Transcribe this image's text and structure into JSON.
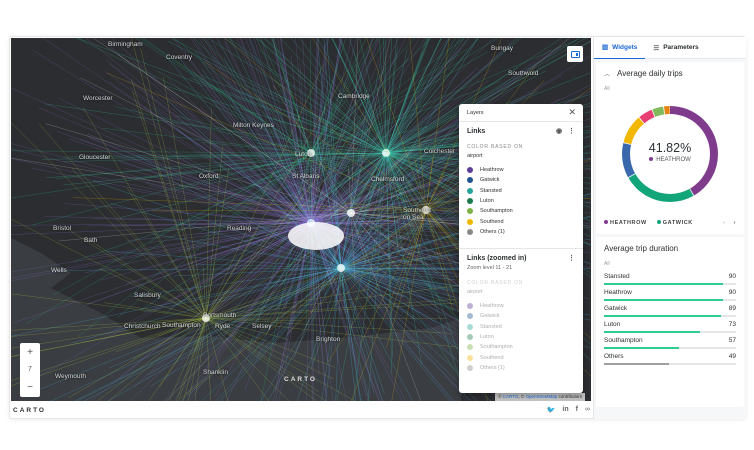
{
  "map": {
    "cities": [
      "Birmingham",
      "Coventry",
      "Bungay",
      "Southwold",
      "Worcester",
      "Cambridge",
      "Milton Keynes",
      "Luton",
      "Colchester",
      "Gloucester",
      "Oxford",
      "St Albans",
      "Chelmsford",
      "Southend",
      "on Sea",
      "Bristol",
      "Bath",
      "Reading",
      "Wells",
      "Salisbury",
      "Southampton",
      "Portsmouth",
      "Ryde",
      "Selsey",
      "Brighton",
      "Christchurch",
      "Weymouth",
      "Shanklin"
    ],
    "zoom_in": "+",
    "zoom_level": "7",
    "zoom_out": "−",
    "watermark": "CARTO",
    "attribution": {
      "prefix": "© ",
      "carto": "CARTO",
      "sep": ", © ",
      "osm": "OpenStreetMap",
      "suffix": " contributors"
    }
  },
  "layers": {
    "title": "Layers",
    "links": {
      "title": "Links",
      "color_based_on": "COLOR BASED ON",
      "attribute": "airport",
      "items": [
        {
          "label": "Heathrow",
          "color": "#5e3c99"
        },
        {
          "label": "Gatwick",
          "color": "#1f5591"
        },
        {
          "label": "Stansted",
          "color": "#26a69a"
        },
        {
          "label": "Luton",
          "color": "#1b7a4a"
        },
        {
          "label": "Southampton",
          "color": "#7cb342"
        },
        {
          "label": "Southend",
          "color": "#f2b701"
        },
        {
          "label": "Others (1)",
          "color": "#888888"
        }
      ]
    },
    "links_zoomed": {
      "title": "Links (zoomed in)",
      "zoom_range": "Zoom level 11 - 21",
      "color_based_on": "COLOR BASED ON",
      "attribute": "airport",
      "items": [
        "Heathrow",
        "Gatwick",
        "Stansted",
        "Luton",
        "Southampton",
        "Southend",
        "Others (1)"
      ]
    }
  },
  "footer": {
    "logo": "CARTO",
    "social": [
      "twitter-icon",
      "linkedin-icon",
      "facebook-icon",
      "link-icon"
    ]
  },
  "panel": {
    "tabs": [
      {
        "label": "Widgets",
        "active": true
      },
      {
        "label": "Parameters",
        "active": false
      }
    ],
    "daily": {
      "title": "Average daily trips",
      "filter": "All",
      "center_value": "41.82%",
      "center_label": "HEATHROW",
      "segments": [
        {
          "name": "HEATHROW",
          "share": 0.4182,
          "color": "#7f3c8d"
        },
        {
          "name": "GATWICK",
          "share": 0.25,
          "color": "#11a579"
        },
        {
          "share": 0.12,
          "color": "#3969ac"
        },
        {
          "share": 0.1,
          "color": "#f2b701"
        },
        {
          "share": 0.05,
          "color": "#e73f74"
        },
        {
          "share": 0.04,
          "color": "#80ba5a"
        },
        {
          "share": 0.0218,
          "color": "#e68310"
        }
      ],
      "legend": [
        {
          "label": "HEATHROW",
          "color": "#7f3c8d"
        },
        {
          "label": "GATWICK",
          "color": "#11a579"
        }
      ]
    },
    "duration": {
      "title": "Average trip duration",
      "filter": "All",
      "max": 100,
      "rows": [
        {
          "label": "Stansted",
          "value": 90
        },
        {
          "label": "Heathrow",
          "value": 90
        },
        {
          "label": "Gatwick",
          "value": 89
        },
        {
          "label": "Luton",
          "value": 73
        },
        {
          "label": "Southampton",
          "value": 57
        },
        {
          "label": "Others",
          "value": 49,
          "color": "#9e9e9e"
        }
      ],
      "bar_color": "#2ecc8f"
    }
  }
}
